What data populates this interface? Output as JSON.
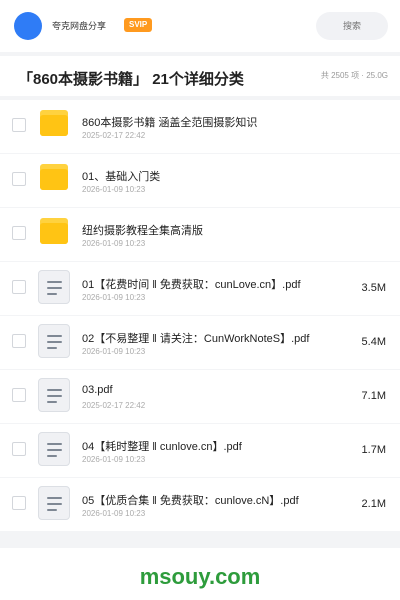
{
  "topbar": {
    "app_name": "夸克网盘分享",
    "badge": "SVIP",
    "search_placeholder": "搜索",
    "colors": {
      "avatar": "#2f7cf6",
      "badge": "#ff9a1f"
    }
  },
  "header": {
    "title": "「860本摄影书籍」 21个详细分类",
    "stats": "共 2505 项 · 25.0G"
  },
  "files": [
    {
      "type": "folder",
      "icon": "folder-icon",
      "name": "860本摄影书籍  涵盖全范围摄影知识",
      "date": "2025-02-17 22:42",
      "size": ""
    },
    {
      "type": "folder",
      "icon": "folder-icon",
      "name": "01、基础入门类",
      "date": "2026-01-09 10:23",
      "size": ""
    },
    {
      "type": "folder",
      "icon": "folder-icon",
      "name": "纽约摄影教程全集高清版",
      "date": "2026-01-09 10:23",
      "size": ""
    },
    {
      "type": "file",
      "icon": "document-icon",
      "name": "01【花费时间 ‖ 免费获取：cunLove.cn】.pdf",
      "date": "2026-01-09 10:23",
      "size": "3.5M"
    },
    {
      "type": "file",
      "icon": "document-icon",
      "name": "02【不易整理 ‖ 请关注：CunWorkNoteS】.pdf",
      "date": "2026-01-09 10:23",
      "size": "5.4M"
    },
    {
      "type": "file",
      "icon": "document-icon",
      "name": "03.pdf",
      "date": "2025-02-17 22:42",
      "size": "7.1M"
    },
    {
      "type": "file",
      "icon": "document-icon",
      "name": "04【耗时整理 ‖ cunlove.cn】.pdf",
      "date": "2026-01-09 10:23",
      "size": "1.7M"
    },
    {
      "type": "file",
      "icon": "document-icon",
      "name": "05【优质合集 ‖ 免费获取：cunlove.cN】.pdf",
      "date": "2026-01-09 10:23",
      "size": "2.1M"
    }
  ],
  "footer": {
    "watermark": "msouy.com",
    "watermark_color": "#2e9c3c"
  }
}
